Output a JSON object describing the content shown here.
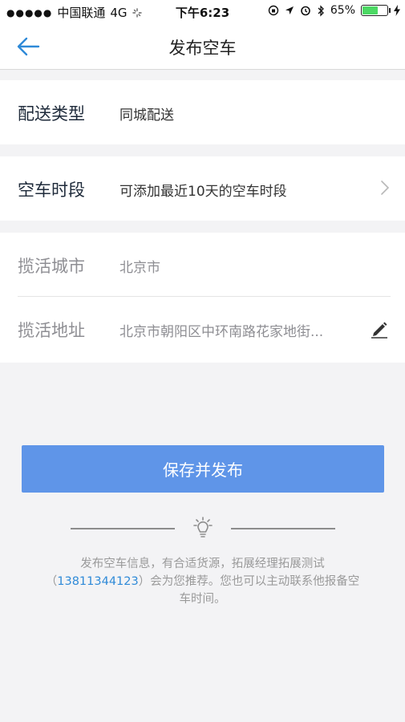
{
  "status_bar": {
    "signal": "●●●●●",
    "carrier": "中国联通",
    "network": "4G",
    "time": "下午6:23",
    "battery_percent": "65%",
    "battery_level": 0.65
  },
  "nav": {
    "title": "发布空车"
  },
  "form": {
    "delivery_type": {
      "label": "配送类型",
      "value": "同城配送"
    },
    "empty_period": {
      "label": "空车时段",
      "value": "可添加最近10天的空车时段"
    },
    "pickup_city": {
      "label": "揽活城市",
      "value": "北京市"
    },
    "pickup_address": {
      "label": "揽活地址",
      "value": "北京市朝阳区中环南路花家地街..."
    }
  },
  "save_button": {
    "label": "保存并发布"
  },
  "hint": {
    "text_before": "发布空车信息，有合适货源，拓展经理拓展测试（",
    "phone": "13811344123",
    "text_after": "）会为您推荐。您也可以主动联系他报备空车时间。"
  },
  "colors": {
    "accent": "#5f95e8",
    "link": "#2f8ad8",
    "background": "#f3f3f5",
    "battery": "#4cd964"
  }
}
